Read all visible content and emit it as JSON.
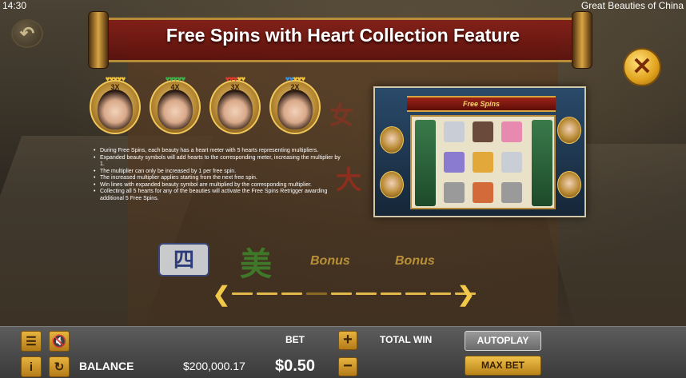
{
  "status": {
    "time": "14:30",
    "game_title": "Great Beauties of China"
  },
  "help": {
    "title": "Free Spins with Heart Collection Feature",
    "back_icon": "back-arrow-icon",
    "close_icon": "close-x-icon",
    "beauties": [
      {
        "multiplier": "3X",
        "heart_colors": [
          "#f2c23a",
          "#f2c23a",
          "#f2c23a",
          "#f2c23a",
          "#f2c23a"
        ]
      },
      {
        "multiplier": "4X",
        "heart_colors": [
          "#3db24a",
          "#3db24a",
          "#3db24a",
          "#3db24a",
          "#3db24a"
        ]
      },
      {
        "multiplier": "3X",
        "heart_colors": [
          "#e23b2e",
          "#e23b2e",
          "#e23b2e",
          "#f2c23a",
          "#f2c23a"
        ]
      },
      {
        "multiplier": "2X",
        "heart_colors": [
          "#3a8fd8",
          "#3a8fd8",
          "#f2c23a",
          "#f2c23a",
          "#f2c23a"
        ]
      }
    ],
    "rules": [
      "During Free Spins, each beauty has a heart meter with 5 hearts representing multipliers.",
      "Expanded beauty symbols will add hearts to the corresponding meter, increasing the multiplier by 1.",
      "The multiplier can only be increased by 1 per free spin.",
      "The increased multiplier applies starting from the next free spin.",
      "Win lines with expanded beauty symbol are multiplied by the corresponding multiplier.",
      "Collecting all 5 hearts for any of the beauties will activate the Free Spins Retrigger awarding additional 5 Free Spins."
    ],
    "preview_banner": "Free Spins",
    "decor": {
      "si": "四",
      "mei": "美",
      "da": "大",
      "nu": "女",
      "bonus": "Bonus"
    },
    "pagination": {
      "count": 10,
      "active_index": 3
    }
  },
  "controls": {
    "menu_icon": "menu-list-icon",
    "sound_icon": "sound-muted-icon",
    "info_icon": "info-icon",
    "history_icon": "history-icon",
    "balance_label": "BALANCE",
    "balance_value": "$200,000.17",
    "bet_label": "BET",
    "bet_value": "$0.50",
    "plus_label": "+",
    "minus_label": "−",
    "total_win_label": "TOTAL WIN",
    "autoplay_label": "AUTOPLAY",
    "maxbet_label": "MAX BET"
  }
}
